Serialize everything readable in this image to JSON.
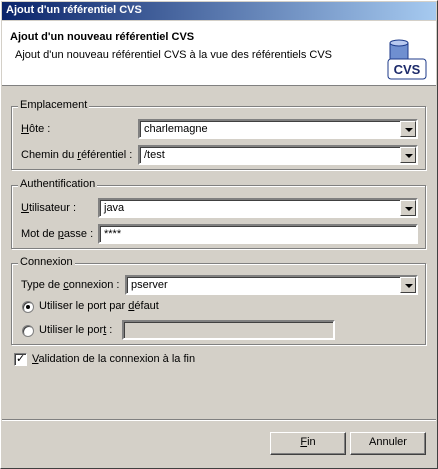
{
  "window": {
    "title": "Ajout d'un référentiel CVS"
  },
  "banner": {
    "title": "Ajout d'un nouveau référentiel CVS",
    "description": "Ajout d'un nouveau référentiel CVS à la vue des référentiels CVS",
    "icon_name": "cvs-repository-icon",
    "icon_text": "CVS"
  },
  "location": {
    "group_title": "Emplacement",
    "host_label_u": "H",
    "host_label_rest": "ôte :",
    "host_value": "charlemagne",
    "path_label_pre": "Chemin du ",
    "path_label_u": "r",
    "path_label_rest": "éférentiel :",
    "path_value": "/test"
  },
  "auth": {
    "group_title": "Authentification",
    "user_label_u": "U",
    "user_label_rest": "tilisateur :",
    "user_value": "java",
    "password_label_pre": "Mot de ",
    "password_label_u": "p",
    "password_label_rest": "asse :",
    "password_value": "****"
  },
  "connection": {
    "group_title": "Connexion",
    "type_label_pre": "Type de ",
    "type_label_u": "c",
    "type_label_rest": "onnexion :",
    "type_value": "pserver",
    "default_port_pre": "Utiliser le port par ",
    "default_port_u": "d",
    "default_port_rest": "éfaut",
    "default_port_selected": true,
    "custom_port_pre": "Utiliser le por",
    "custom_port_u": "t",
    "custom_port_rest": " :",
    "custom_port_value": ""
  },
  "validation": {
    "label_u": "V",
    "label_rest": "alidation de la connexion à la fin",
    "checked": true
  },
  "buttons": {
    "finish_u": "F",
    "finish_rest": "in",
    "cancel": "Annuler"
  }
}
